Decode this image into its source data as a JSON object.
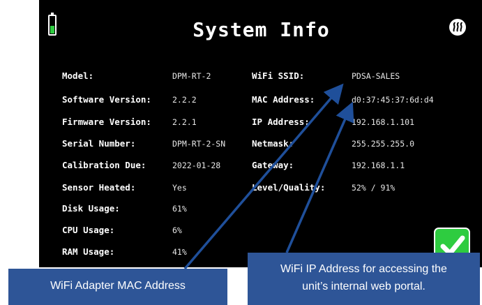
{
  "header": {
    "title": "System Info",
    "battery_icon": "battery-icon",
    "heater_icon": "sensor-heater-icon"
  },
  "left_fields": [
    {
      "label": "Model:",
      "value": "DPM-RT-2"
    },
    {
      "label": "Software Version:",
      "value": "2.2.2"
    },
    {
      "label": "Firmware Version:",
      "value": "2.2.1"
    },
    {
      "label": "Serial Number:",
      "value": "DPM-RT-2-SN"
    },
    {
      "label": "Calibration Due:",
      "value": "2022-01-28"
    },
    {
      "label": "Sensor Heated:",
      "value": "Yes"
    },
    {
      "label": "Disk Usage:",
      "value": "61%"
    },
    {
      "label": "CPU Usage:",
      "value": "6%"
    },
    {
      "label": "RAM Usage:",
      "value": "41%"
    }
  ],
  "right_fields": [
    {
      "label": "WiFi SSID:",
      "value": "PDSA-SALES"
    },
    {
      "label": "MAC Address:",
      "value": "d0:37:45:37:6d:d4"
    },
    {
      "label": "IP Address:",
      "value": "192.168.1.101"
    },
    {
      "label": "Netmask:",
      "value": "255.255.255.0"
    },
    {
      "label": "Gateway:",
      "value": "192.168.1.1"
    },
    {
      "label": "Level/Quality:",
      "value": "52% / 91%"
    }
  ],
  "confirm_button": {
    "icon": "checkmark-icon"
  },
  "callouts": {
    "mac": "WiFi Adapter MAC Address",
    "ip_line1": "WiFi IP Address for accessing the",
    "ip_line2": "unit’s internal web portal."
  },
  "colors": {
    "screen_bg": "#000000",
    "accent_green": "#2ecc40",
    "callout_blue": "#2e5597",
    "arrow_blue": "#1f4f9a"
  }
}
